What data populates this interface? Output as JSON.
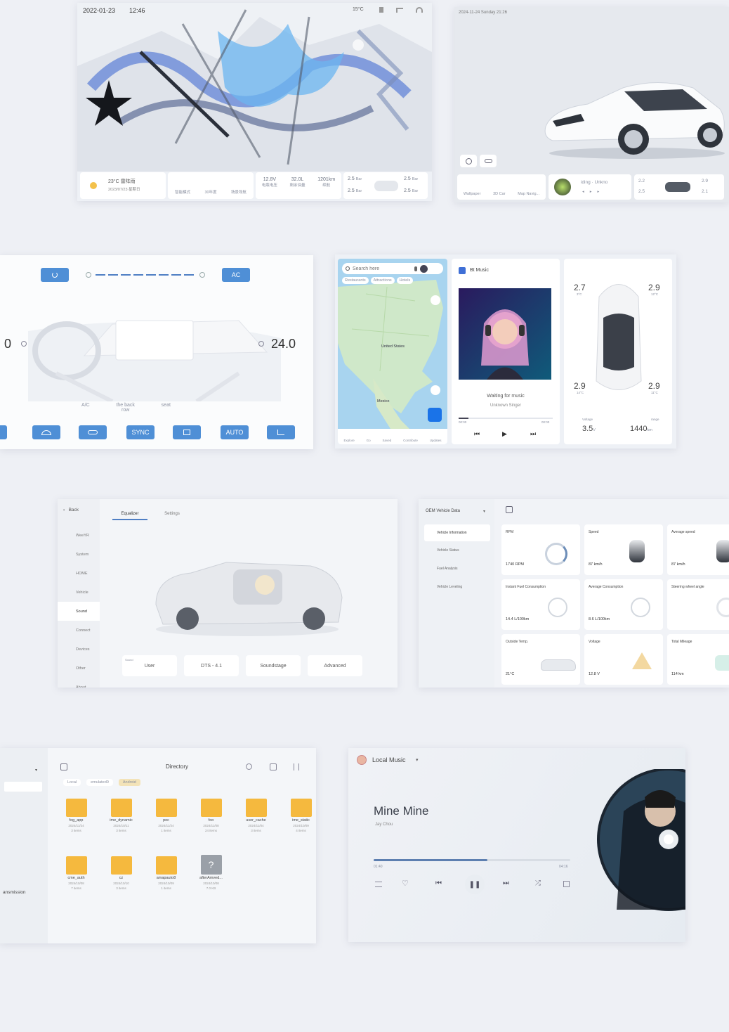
{
  "panel_home": {
    "date": "2022-01-23",
    "time": "12:46",
    "temp": "15°C",
    "weather_line1": "23°C 雷阵雨",
    "weather_line2": "2023/07/23 星期日",
    "mode_labels": [
      "智能模式",
      "30年度",
      "场景导航"
    ],
    "stat_values": [
      "12.8V",
      "32.0L",
      "1201km"
    ],
    "stat_labels": [
      "电瓶电压",
      "剩余油量",
      "续航"
    ],
    "tire_values": [
      "2.5",
      "2.5",
      "2.5",
      "2.5"
    ],
    "tire_unit": "Bar"
  },
  "panel_car3d": {
    "header": "2024-11-24 Sunday 21:26",
    "dock_labels": [
      "Wallpaper",
      "3D Car",
      "Map Navig..."
    ],
    "music_text": "iding · Unkno",
    "tire_values": [
      "2.2",
      "2.9",
      "2.5",
      "2.1"
    ],
    "tire_unit": "Bar"
  },
  "panel_climate": {
    "ac_label": "AC",
    "left_temp": "0",
    "right_temp": "24.0",
    "mode_labels": [
      "A/C",
      "the back row",
      "seat"
    ],
    "bottom_buttons": [
      "SYNC",
      "AUTO"
    ]
  },
  "panel_map": {
    "search_placeholder": "Search here",
    "chips": [
      "Restaurants",
      "Attractions",
      "Hotels"
    ],
    "map_labels": [
      "United States",
      "Mexico"
    ],
    "nav_labels": [
      "Explore",
      "Go",
      "Saved",
      "Contribute",
      "Updates"
    ],
    "music_title": "Bt Music",
    "song": "Waiting for music",
    "artist": "Unknown Singer",
    "time_start": "00:00",
    "time_end": "00:00",
    "tires": [
      "2.7",
      "2.9",
      "2.9",
      "2.9"
    ],
    "tire_temps": [
      "3°C",
      "12°C",
      "14°C",
      "11°C"
    ],
    "voltage_label": "Voltage",
    "voltage": "3.5",
    "voltage_unit": "V",
    "range_label": "range",
    "range": "1440",
    "range_unit": "km"
  },
  "panel_sound": {
    "back": "Back",
    "menu": [
      "WeeYR",
      "System",
      "HOME",
      "Vehicle",
      "Sound",
      "Connect",
      "Devices",
      "Other",
      "About"
    ],
    "tabs": [
      "Equalizer",
      "Settings"
    ],
    "bottom_tabs": [
      "User",
      "DTS - 4.1",
      "Soundstage",
      "Advanced"
    ],
    "bottom_prefix": "Sound"
  },
  "panel_obd": {
    "header": "OEM Vehicle Data",
    "menu": [
      "Vehicle Information",
      "Vehicle Status",
      "Fuel Analysis",
      "Vehicle Leveling"
    ],
    "cards": [
      {
        "label": "RPM",
        "value": "1740 RPM"
      },
      {
        "label": "Speed",
        "value": "87 km/h"
      },
      {
        "label": "Average speed",
        "value": "87 km/h"
      },
      {
        "label": "Instant Fuel Consumption",
        "value": "14.4 L/100km"
      },
      {
        "label": "Average Consumption",
        "value": "8.6 L/100km"
      },
      {
        "label": "Steering wheel angle",
        "value": ""
      },
      {
        "label": "Outside Temp.",
        "value": "21°C"
      },
      {
        "label": "Voltage",
        "value": "12.8 V"
      },
      {
        "label": "Total Mileage",
        "value": "114 km"
      }
    ]
  },
  "panel_files": {
    "side_label": "ansmission",
    "title": "Directory",
    "crumbs": [
      "Local",
      "emulated0",
      "Android"
    ],
    "folders": [
      {
        "name": "fog_app",
        "date": "2024/11/24",
        "count": "3 items"
      },
      {
        "name": "ime_dynamic",
        "date": "2024/10/11",
        "count": "3 items"
      },
      {
        "name": "poc",
        "date": "2024/11/24",
        "count": "1 items"
      },
      {
        "name": "foo",
        "date": "2024/11/08",
        "count": "24 items"
      },
      {
        "name": "user_cache",
        "date": "2024/11/04",
        "count": "3 items"
      },
      {
        "name": "ime_static",
        "date": "2024/10/09",
        "count": "4 items"
      },
      {
        "name": "cme_auth",
        "date": "2024/10/08",
        "count": "7 items"
      },
      {
        "name": "cz",
        "date": "2024/10/10",
        "count": "3 items"
      },
      {
        "name": "amapauto8",
        "date": "2024/10/09",
        "count": "1 items"
      },
      {
        "name": "afterAmved...",
        "date": "2024/10/08",
        "count": "7.0 KB"
      }
    ]
  },
  "panel_music": {
    "source": "Local Music",
    "song": "Mine Mine",
    "artist": "Jay Chou",
    "time_start": "01:40",
    "time_end": "04:16",
    "progress": 0.58
  }
}
